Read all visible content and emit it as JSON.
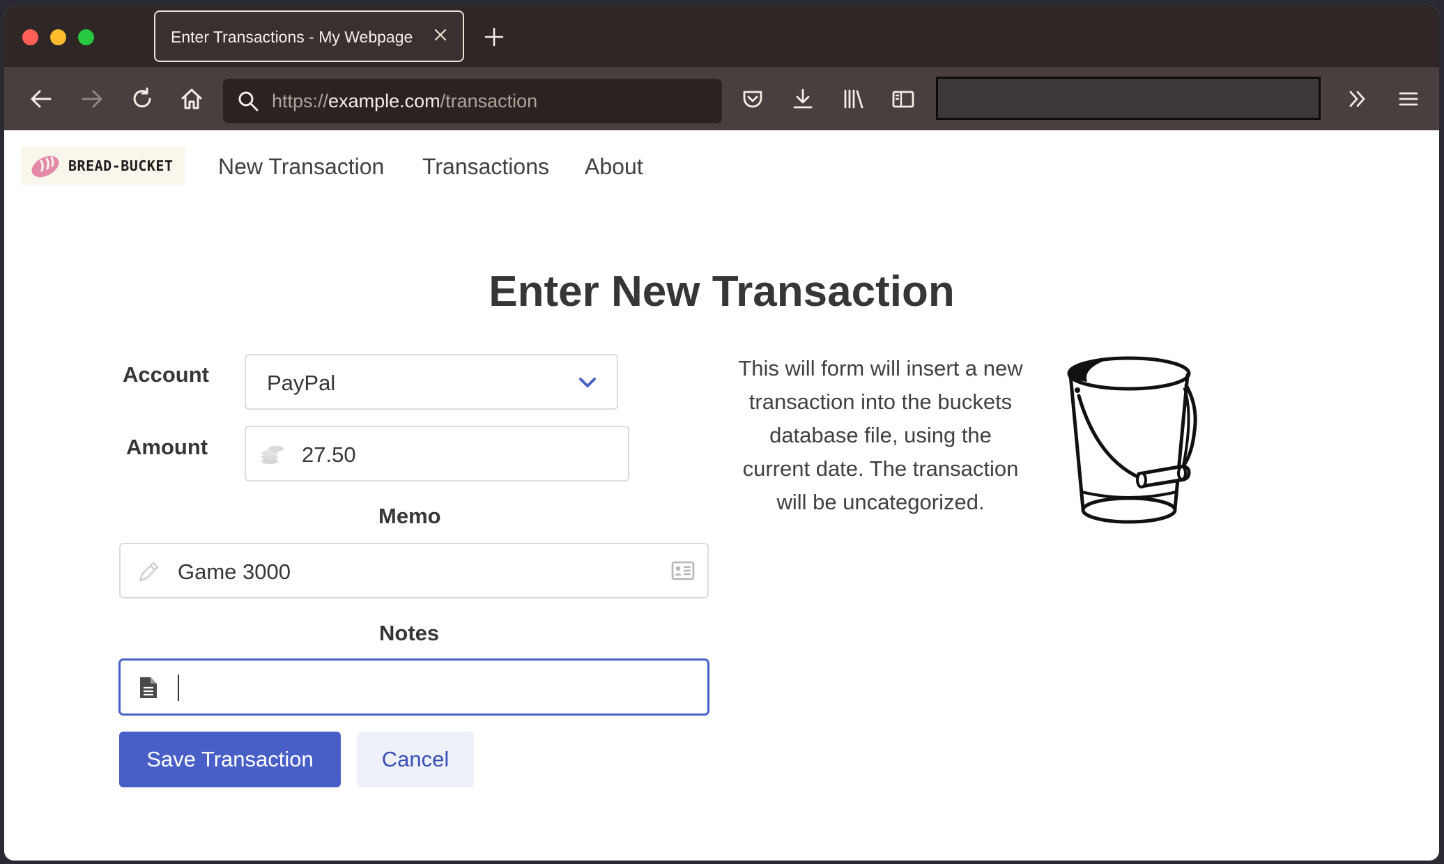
{
  "browser": {
    "tab_title": "Enter Transactions - My Webpage",
    "url_scheme": "https://",
    "url_host": "example.com",
    "url_path": "/transaction"
  },
  "site": {
    "brand": "BREAD-BUCKET",
    "nav": [
      "New Transaction",
      "Transactions",
      "About"
    ]
  },
  "form": {
    "title": "Enter New Transaction",
    "account_label": "Account",
    "account_value": "PayPal",
    "amount_label": "Amount",
    "amount_value": "27.50",
    "memo_label": "Memo",
    "memo_value": "Game 3000",
    "notes_label": "Notes",
    "notes_value": "",
    "save_label": "Save Transaction",
    "cancel_label": "Cancel"
  },
  "description": "This will form will insert a new transaction into the buckets database file, using the current date. The transaction will be uncategorized.",
  "colors": {
    "primary": "#485fc7",
    "tabstrip": "#2f2626",
    "navbar": "#4a3f3f"
  }
}
